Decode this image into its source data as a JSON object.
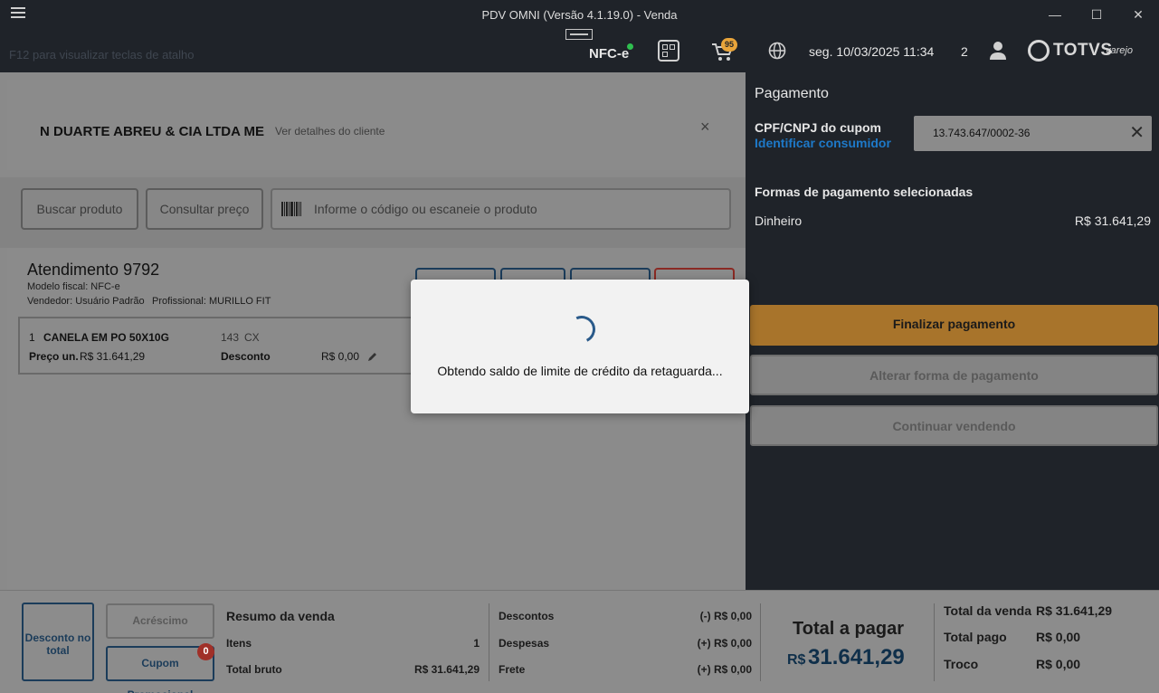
{
  "window": {
    "title": "PDV OMNI (Versão 4.1.19.0) - Venda",
    "minimize_icon": "minimize-icon",
    "maximize_icon": "maximize-icon",
    "close_icon": "close-icon"
  },
  "header": {
    "hint": "F12 para visualizar teclas de atalho",
    "nfce_label": "NFC-e",
    "nfce_status_color": "#2fbf4f",
    "cart_badge": "95",
    "datetime": "seg. 10/03/2025 11:34",
    "user_count": "2",
    "brand": "TOTVS",
    "brand_sub": "varejo"
  },
  "customer": {
    "name": "N DUARTE ABREU & CIA LTDA ME",
    "details_link": "Ver detalhes do cliente",
    "close_label": "×"
  },
  "search": {
    "buscar_label": "Buscar produto",
    "consultar_label": "Consultar preço",
    "product_placeholder": "Informe o código ou escaneie o produto"
  },
  "attendance": {
    "title": "Atendimento 9792",
    "model": "Modelo fiscal: NFC-e",
    "seller": "Vendedor: Usuário Padrão",
    "professional": "Profissional: MURILLO FIT"
  },
  "items": [
    {
      "index": "1",
      "name": "CANELA EM PO 50X10G",
      "qty": "143",
      "unit": "CX",
      "price_label": "Preço un.",
      "price": "R$ 31.641,29",
      "discount_label": "Desconto",
      "discount": "R$ 0,00"
    }
  ],
  "payment": {
    "title": "Pagamento",
    "cpf_label": "CPF/CNPJ do cupom",
    "identify_link": "Identificar consumidor",
    "cpf_value": "13.743.647/0002-36",
    "clear_label": "✕",
    "forms_title": "Formas de pagamento selecionadas",
    "methods": [
      {
        "name": "Dinheiro",
        "amount": "R$ 31.641,29"
      }
    ],
    "finalize_label": "Finalizar pagamento",
    "change_label": "Alterar forma de pagamento",
    "continue_label": "Continuar vendendo",
    "accent_color": "#a8742b"
  },
  "footer": {
    "desconto_label": "Desconto no total",
    "acrescimo_label": "Acréscimo",
    "cupom_label": "Cupom Promocional",
    "cupom_badge": "0",
    "summary_title": "Resumo da venda",
    "itens_label": "Itens",
    "itens_value": "1",
    "bruto_label": "Total bruto",
    "bruto_value": "R$ 31.641,29",
    "descontos_label": "Descontos",
    "descontos_value": "(-) R$ 0,00",
    "despesas_label": "Despesas",
    "despesas_value": "(+) R$ 0,00",
    "frete_label": "Frete",
    "frete_value": "(+) R$ 0,00",
    "total_pagar_label": "Total a pagar",
    "total_currency": "R$",
    "total_pagar_value": "31.641,29",
    "total_venda_label": "Total da venda",
    "total_venda_value": "R$ 31.641,29",
    "total_pago_label": "Total pago",
    "total_pago_value": "R$ 0,00",
    "troco_label": "Troco",
    "troco_value": "R$ 0,00"
  },
  "modal": {
    "message": "Obtendo saldo de limite de crédito da retaguarda..."
  }
}
